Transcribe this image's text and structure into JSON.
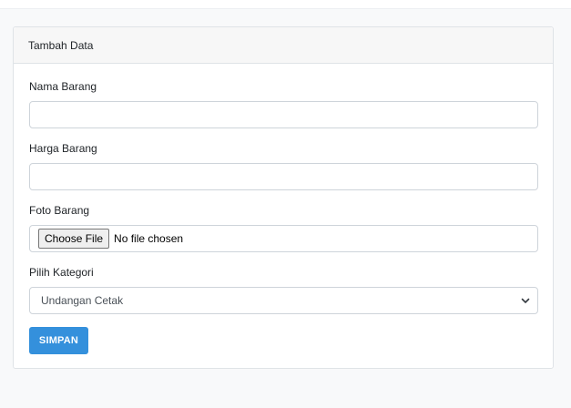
{
  "card": {
    "header_title": "Tambah Data"
  },
  "form": {
    "nama_label": "Nama Barang",
    "nama_value": "",
    "harga_label": "Harga Barang",
    "harga_value": "",
    "foto_label": "Foto Barang",
    "foto_button": "Choose File",
    "foto_status": "No file chosen",
    "kategori_label": "Pilih Kategori",
    "kategori_selected": "Undangan Cetak",
    "submit_label": "SIMPAN"
  },
  "icons": {
    "select_arrow": "chevron-down-icon"
  },
  "colors": {
    "primary": "#3490dc",
    "page_bg": "#f8f9fa",
    "border": "#ced4da"
  }
}
